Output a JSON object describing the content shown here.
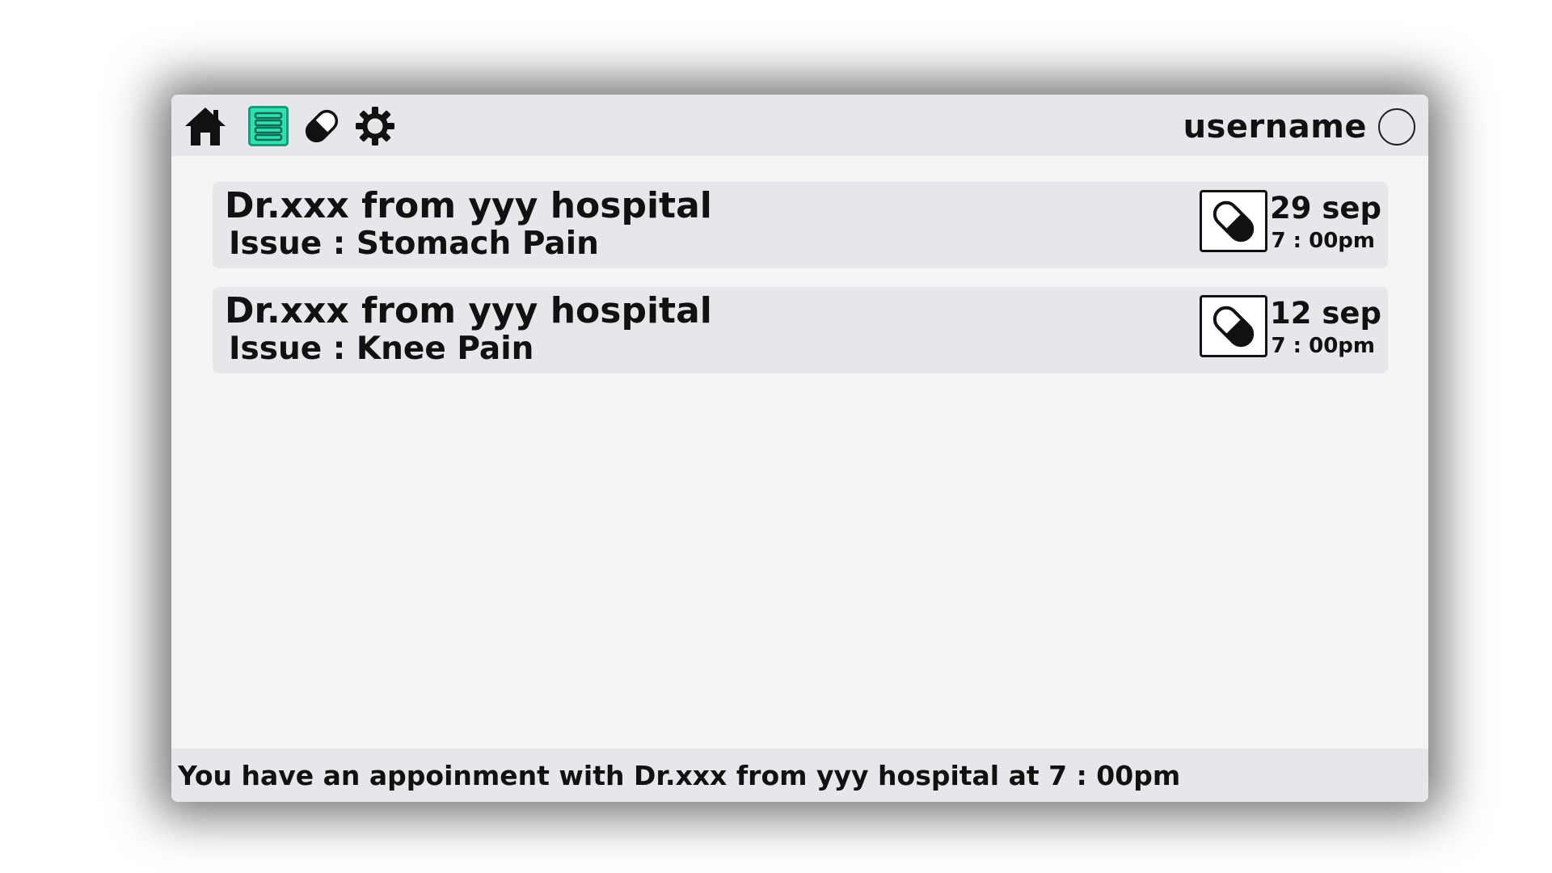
{
  "header": {
    "nav_icons": [
      "home-icon",
      "list-icon",
      "pill-icon",
      "gear-icon"
    ],
    "active_nav_icon": "list-icon",
    "active_color": "#2fe0b0",
    "username": "username"
  },
  "appointments": [
    {
      "doctor": "Dr.xxx from yyy hospital",
      "issue": "Issue : Stomach Pain",
      "icon": "pill-icon",
      "date": "29 sep",
      "time": "7 : 00pm"
    },
    {
      "doctor": "Dr.xxx from yyy hospital",
      "issue": "Issue : Knee Pain",
      "icon": "pill-icon",
      "date": "12 sep",
      "time": "7 : 00pm"
    }
  ],
  "footer": {
    "message": "You have an appoinment with Dr.xxx from yyy hospital at 7 : 00pm"
  }
}
